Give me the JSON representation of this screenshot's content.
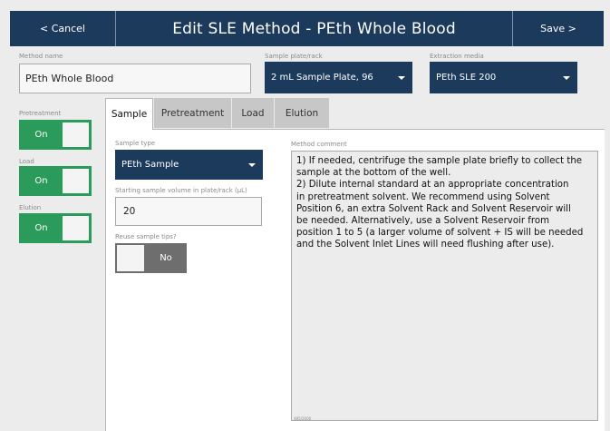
{
  "header": {
    "cancel_label": "< Cancel",
    "title": "Edit SLE Method - PEth Whole Blood",
    "save_label": "Save >"
  },
  "method_name": {
    "label": "Method name",
    "value": "PEth Whole Blood"
  },
  "sample_plate": {
    "label": "Sample plate/rack",
    "value": "2 mL Sample Plate, 96"
  },
  "extraction_media": {
    "label": "Extraction media",
    "value": "PEth SLE 200"
  },
  "toggles": [
    {
      "label": "Pretreatment",
      "state": "On"
    },
    {
      "label": "Load",
      "state": "On"
    },
    {
      "label": "Elution",
      "state": "On"
    }
  ],
  "tabs": [
    {
      "label": "Sample",
      "active": true
    },
    {
      "label": "Pretreatment",
      "active": false
    },
    {
      "label": "Load",
      "active": false
    },
    {
      "label": "Elution",
      "active": false
    }
  ],
  "sample_type": {
    "label": "Sample type",
    "value": "PEth Sample"
  },
  "starting_volume": {
    "label": "Starting sample volume in plate/rack (µL)",
    "value": "20"
  },
  "reuse_tips": {
    "label": "Reuse sample tips?",
    "state": "No"
  },
  "method_comment": {
    "label": "Method comment",
    "lines": [
      "1) If needed, centrifuge the sample plate briefly to collect the",
      "sample at the bottom of the well.",
      "2) Dilute internal standard at an appropriate concentration",
      "in pretreatment solvent. We recommend using Solvent",
      "Position 6, an extra Solvent Rack and Solvent Reservoir will",
      "be needed. Alternatively, use a Solvent Reservoir from",
      "position 1 to 5 (a larger volume of solvent + IS will be needed",
      "and the Solvent Inlet Lines will need flushing after use)."
    ],
    "char_counter": "485/2000"
  }
}
